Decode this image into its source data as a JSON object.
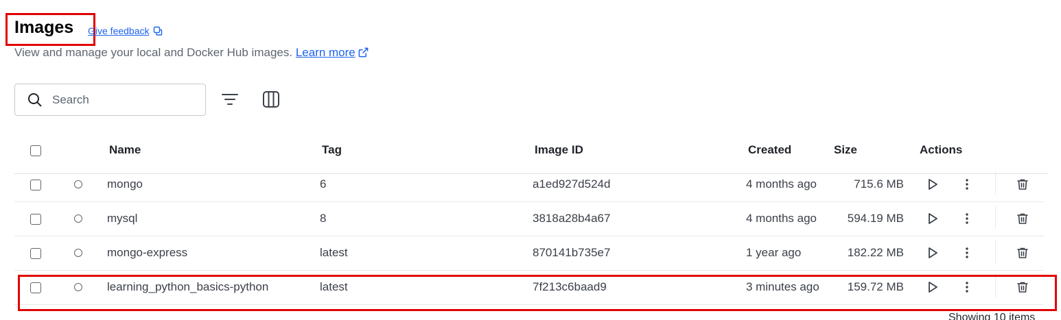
{
  "header": {
    "title": "Images",
    "feedback_label": "Give feedback",
    "subtitle_text": "View and manage your local and Docker Hub images. ",
    "learn_more_label": "Learn more"
  },
  "toolbar": {
    "search_placeholder": "Search"
  },
  "table": {
    "columns": [
      "Name",
      "Tag",
      "Image ID",
      "Created",
      "Size",
      "Actions"
    ],
    "rows": [
      {
        "name": "mongo",
        "tag": "6",
        "image_id": "a1ed927d524d",
        "created": "4 months ago",
        "size": "715.6 MB"
      },
      {
        "name": "mysql",
        "tag": "8",
        "image_id": "3818a28b4a67",
        "created": "4 months ago",
        "size": "594.19 MB"
      },
      {
        "name": "mongo-express",
        "tag": "latest",
        "image_id": "870141b735e7",
        "created": "1 year ago",
        "size": "182.22 MB"
      },
      {
        "name": "learning_python_basics-python",
        "tag": "latest",
        "image_id": "7f213c6baad9",
        "created": "3 minutes ago",
        "size": "159.72 MB"
      }
    ]
  },
  "footer": {
    "count_text": "Showing 10 items"
  },
  "colors": {
    "accent": "#1d63ed",
    "annotation_red": "#e10000",
    "text_muted": "#5e6670"
  },
  "icons": [
    "external-link-icon",
    "search-icon",
    "filter-icon",
    "columns-icon",
    "play-icon",
    "kebab-menu-icon",
    "trash-icon"
  ]
}
